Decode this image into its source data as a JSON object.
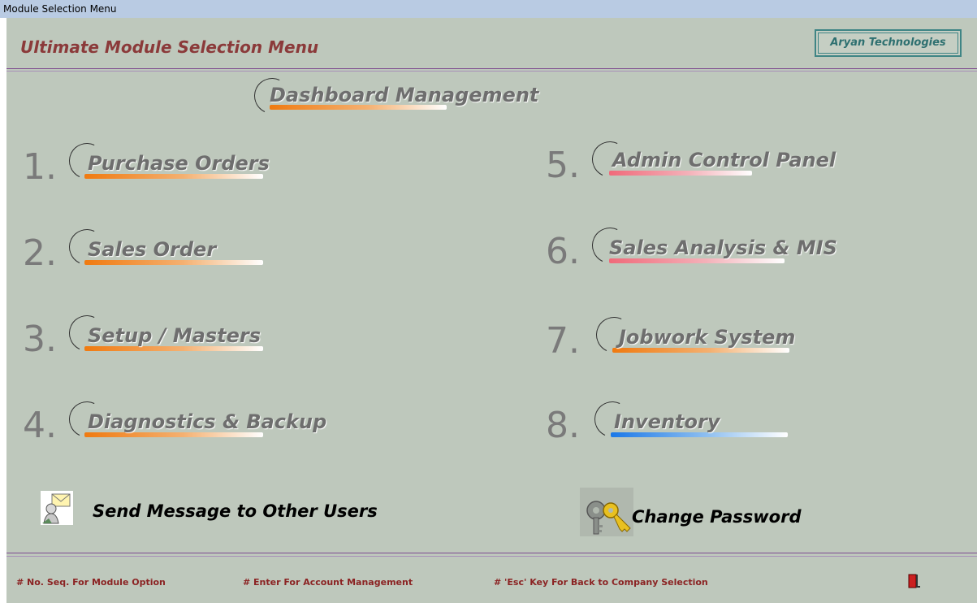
{
  "window": {
    "title": "Module Selection Menu"
  },
  "header": {
    "title": "Ultimate Module Selection Menu",
    "brand": "Aryan Technologies"
  },
  "dashboard": {
    "label": "Dashboard Management"
  },
  "modules": [
    {
      "num": "1.",
      "label": "Purchase Orders"
    },
    {
      "num": "2.",
      "label": "Sales Order"
    },
    {
      "num": "3.",
      "label": "Setup / Masters"
    },
    {
      "num": "4.",
      "label": "Diagnostics & Backup"
    },
    {
      "num": "5.",
      "label": "Admin Control Panel"
    },
    {
      "num": "6.",
      "label": "Sales Analysis & MIS"
    },
    {
      "num": "7.",
      "label": "Jobwork System"
    },
    {
      "num": "8.",
      "label": "Inventory"
    }
  ],
  "actions": {
    "send_message": "Send Message to Other Users",
    "change_password": "Change Password"
  },
  "footer": {
    "hint1": "# No. Seq. For Module Option",
    "hint2": "# Enter For Account  Management",
    "hint3": "# 'Esc' Key For Back to Company Selection"
  },
  "colors": {
    "title": "#8b3a3a",
    "hint": "#8b2323",
    "background": "#bec8bc",
    "titlebar": "#b9cbe3"
  },
  "icons": {
    "send_message": "mail-user-icon",
    "change_password": "keys-icon",
    "exit": "exit-door-icon"
  }
}
